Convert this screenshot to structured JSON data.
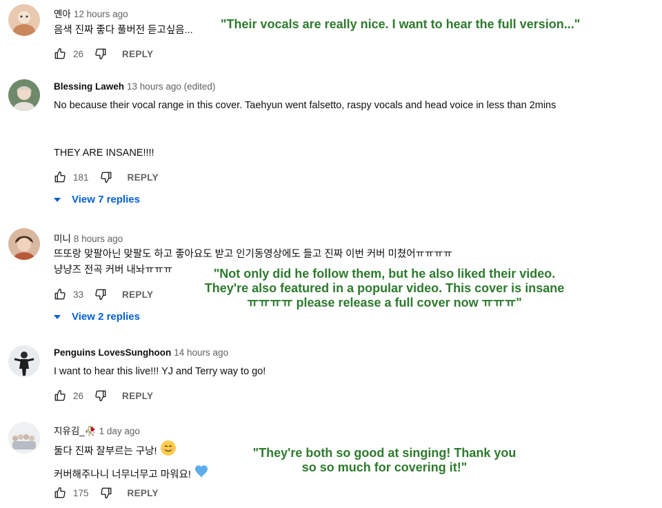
{
  "comments": [
    {
      "author": "옌아",
      "time": "12 hours ago",
      "lines": [
        "음색 진짜 좋다 풀버전 듣고싶음..."
      ],
      "likes": "26",
      "reply_label": "REPLY"
    },
    {
      "author": "Blessing Laweh",
      "time": "13 hours ago (edited)",
      "lines": [
        "No because their vocal range in this cover. Taehyun went falsetto, raspy vocals and head voice in less than 2mins",
        "THEY ARE INSANE!!!!"
      ],
      "likes": "181",
      "reply_label": "REPLY",
      "view_replies": "View 7 replies"
    },
    {
      "author": "미니",
      "time": "8 hours ago",
      "lines": [
        "뜨또랑 맞팔아닌 맞팔도 하고 좋아요도 받고 인기동영상에도 들고 진짜 이번 커버 미쳤어ㅠㅠㅠㅠ",
        "냥냥즈 전곡 커버 내놔ㅠㅠㅠ"
      ],
      "likes": "33",
      "reply_label": "REPLY",
      "view_replies": "View 2 replies"
    },
    {
      "author": "Penguins LovesSunghoon",
      "time": "14 hours ago",
      "lines": [
        "I want to hear this live!!! YJ and Terry way to go!"
      ],
      "likes": "26",
      "reply_label": "REPLY"
    },
    {
      "author": "지유김_🥀",
      "time": "1 day ago",
      "lines": [
        "둘다 진짜 잘부르는 구낭!",
        "커버해주나니 너무너무고 마워요!"
      ],
      "likes": "175",
      "reply_label": "REPLY"
    }
  ],
  "translations": {
    "t1": "\"Their vocals are really nice. I want to hear the full version...\"",
    "t3_line1": "\"Not only did he follow them, but he also liked their video.",
    "t3_line2": "They're also featured in a popular video. This cover is insane",
    "t3_line3": "ㅠㅠㅠㅠ please release a full cover now ㅠㅠㅠ\"",
    "t5_line1": "\"They're both so good at singing! Thank you",
    "t5_line2": "so so much for covering it!\""
  },
  "colors": {
    "translation_green": "#2d7a2d",
    "link_blue": "#065fd4",
    "muted_gray": "#606060"
  },
  "icons": [
    "thumbs-up-icon",
    "thumbs-down-icon",
    "caret-down-icon",
    "smiling-face-emoji",
    "blue-heart-emoji"
  ]
}
